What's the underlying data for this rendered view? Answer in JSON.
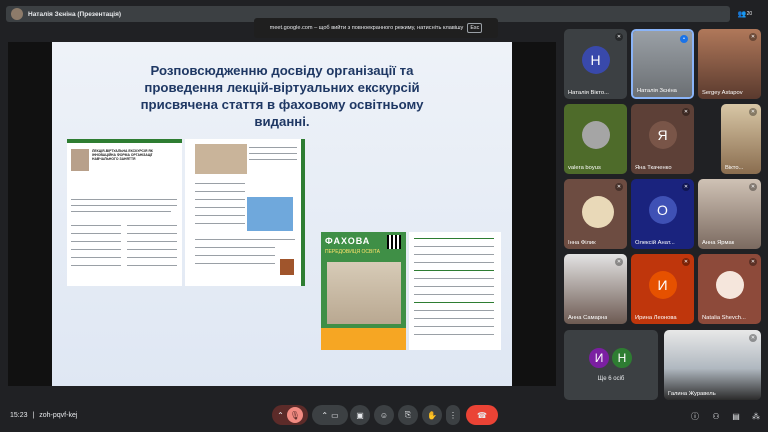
{
  "presenter_bar": {
    "title": "Наталія Зєніна (Презентація)"
  },
  "top_right_badge": "20",
  "fullscreen_hint": {
    "text": "meet.google.com – щоб вийти з повноекранного режиму, натисніть клавішу",
    "key": "Esc"
  },
  "slide": {
    "title_lines": [
      "Розповсюдженню досвіду організації та",
      "проведення лекцій-віртуальних екскурсій",
      "присвячена стаття в фаховому освітньому",
      "виданні."
    ],
    "article_heading": "ЛЕКЦІЯ-ВІРТУАЛЬНА ЕКСКУРСІЯ ЯК ІННОВАЦІЙНА ФОРМА ОРГАНІЗАЦІЇ НАВЧАЛЬНОГО ЗАНЯТТЯ",
    "magazine_title": "ФАХОВА",
    "magazine_subtitle": "ПЕРЕДОВИЦЯ ОСВІТА"
  },
  "participants": [
    {
      "name": "Наталія Вікто...",
      "initial": "Н",
      "color": "#3949ab"
    },
    {
      "name": "Наталія Зєніна",
      "initial": "",
      "color": "#5f6368"
    },
    {
      "name": "Sergey Astapov",
      "initial": "",
      "color": "#8d5a3c"
    },
    {
      "name": "valera boyus",
      "initial": "",
      "color": "#558b2f"
    },
    {
      "name": "Яна Ткаченко",
      "initial": "Я",
      "color": "#795548"
    },
    {
      "name": "Вікто...",
      "initial": "",
      "color": "#c2a87a"
    },
    {
      "name": "Інна Філик",
      "initial": "",
      "color": "#a1887f"
    },
    {
      "name": "Олексій Анат...",
      "initial": "О",
      "color": "#3f51b5"
    },
    {
      "name": "Анна Ярмак",
      "initial": "",
      "color": "#8a7a70"
    },
    {
      "name": "Анна Самарна",
      "initial": "",
      "color": "#6d5a52"
    },
    {
      "name": "Ирина Леонова",
      "initial": "И",
      "color": "#e65100"
    },
    {
      "name": "Natalia Shevch...",
      "initial": "",
      "color": "#9e9e9e"
    },
    {
      "name": "Галина Журавель",
      "initial": "",
      "color": "#7f8c99"
    }
  ],
  "more_tile": {
    "a1": "И",
    "a2": "Н",
    "label": "Ще 6 осіб"
  },
  "bottom": {
    "time": "15:23",
    "separator": "|",
    "meeting_code": "zoh-pqvf-kej"
  },
  "colors": {
    "accent_red": "#ea4335",
    "bar_bg": "#3c4043",
    "title_blue": "#1f3864"
  }
}
